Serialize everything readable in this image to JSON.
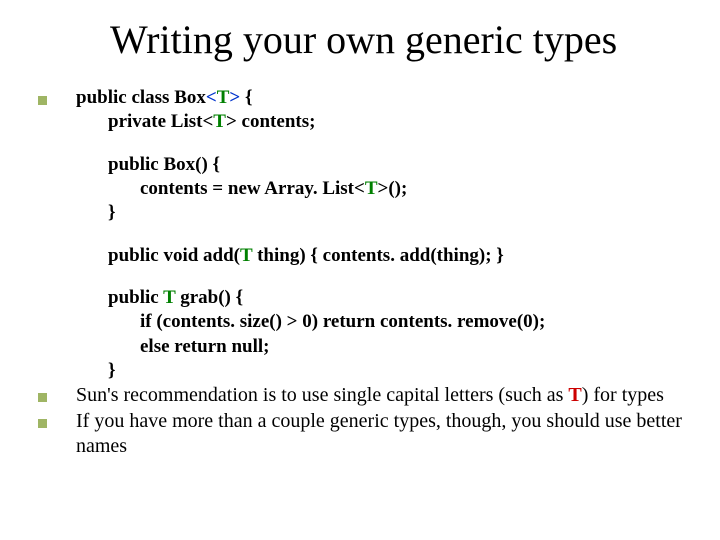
{
  "title": "Writing your own generic types",
  "code": {
    "l1a": "public class Box",
    "l1b": "<",
    "l1c": "T",
    "l1d": ">",
    "l1e": " {",
    "l2a": "private List<",
    "l2b": "T",
    "l2c": "> contents;",
    "l3a": "public Box() {",
    "l4a": "contents = new Array. List<",
    "l4b": "T",
    "l4c": ">();",
    "l5a": "}",
    "l6a": "public void add(",
    "l6b": "T",
    "l6c": " thing) { contents. add(thing); }",
    "l7a": "public ",
    "l7b": "T",
    "l7c": " grab() {",
    "l8a": "if (contents. size() > 0) return contents. remove(0);",
    "l9a": "else return null;",
    "l10a": "}"
  },
  "notes": {
    "n1a": "Sun's recommendation is to use single capital letters (such as ",
    "n1b": "T",
    "n1c": ") for types",
    "n2": "If you have more than a couple generic types, though, you should use better names"
  }
}
